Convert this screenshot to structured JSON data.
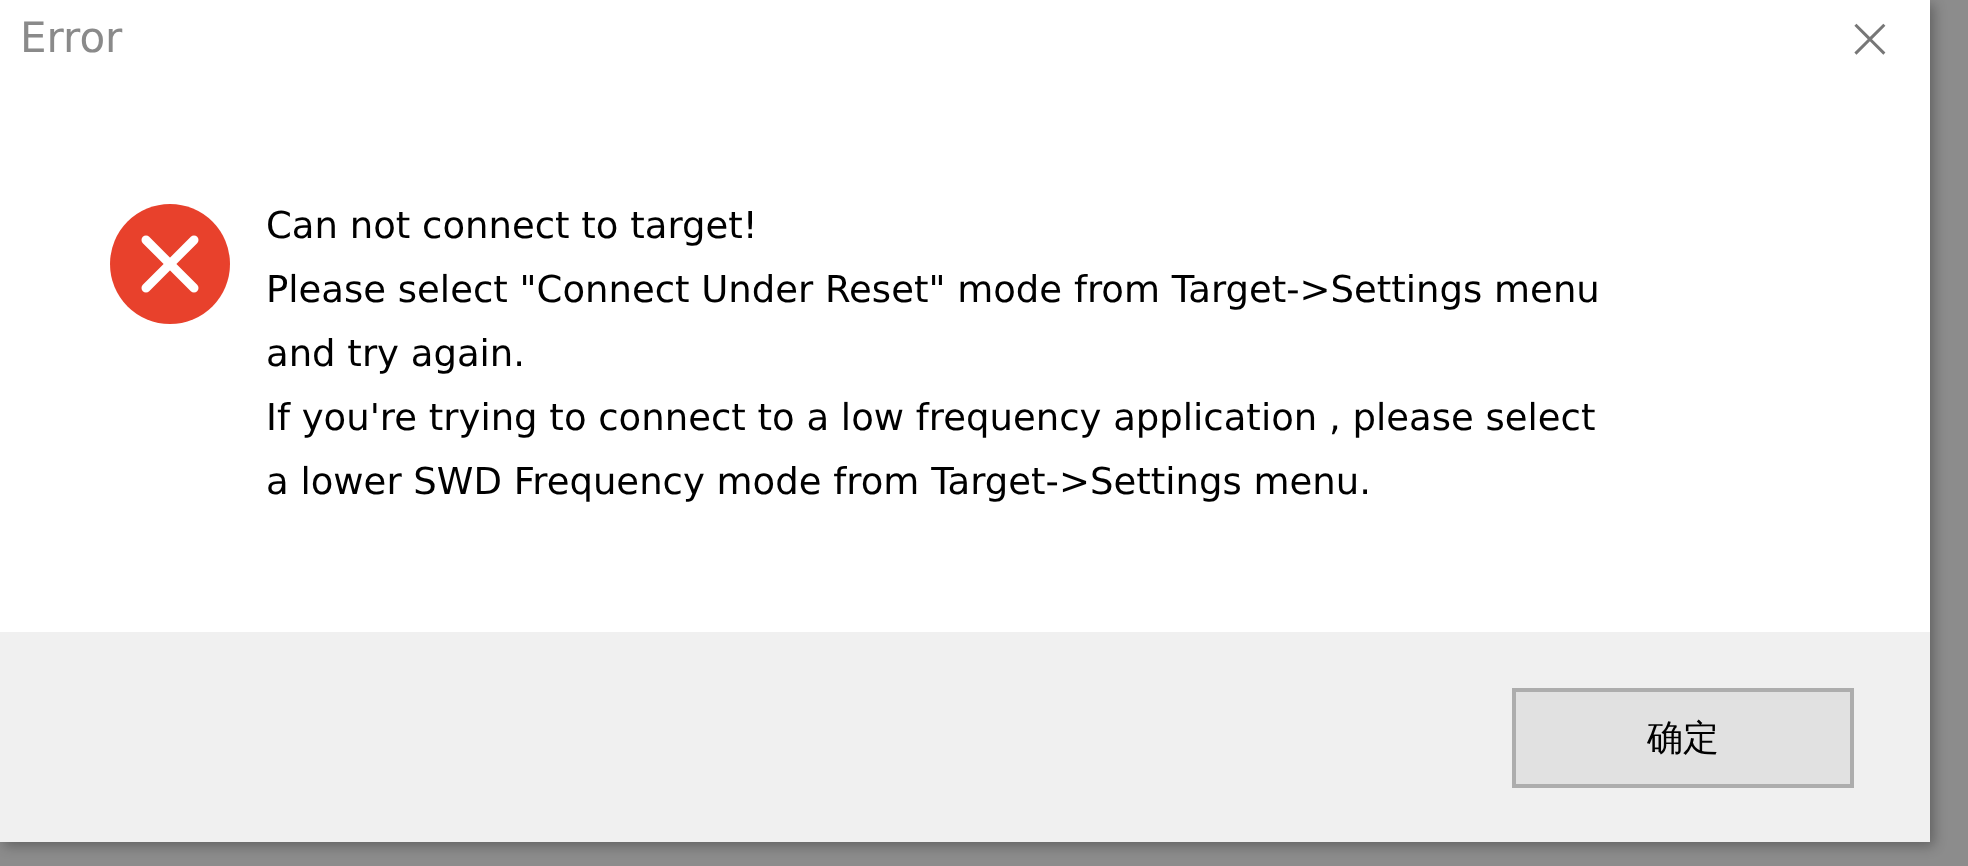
{
  "window": {
    "title": "Error",
    "close": "×"
  },
  "message": {
    "lines": [
      "Can not connect to target!",
      "Please select \"Connect Under Reset\" mode from Target->Settings menu",
      "and try again.",
      "If you're trying to connect to a low frequency application , please select",
      "a lower SWD Frequency mode from Target->Settings menu."
    ]
  },
  "buttons": [
    {
      "label": "确定"
    }
  ]
}
